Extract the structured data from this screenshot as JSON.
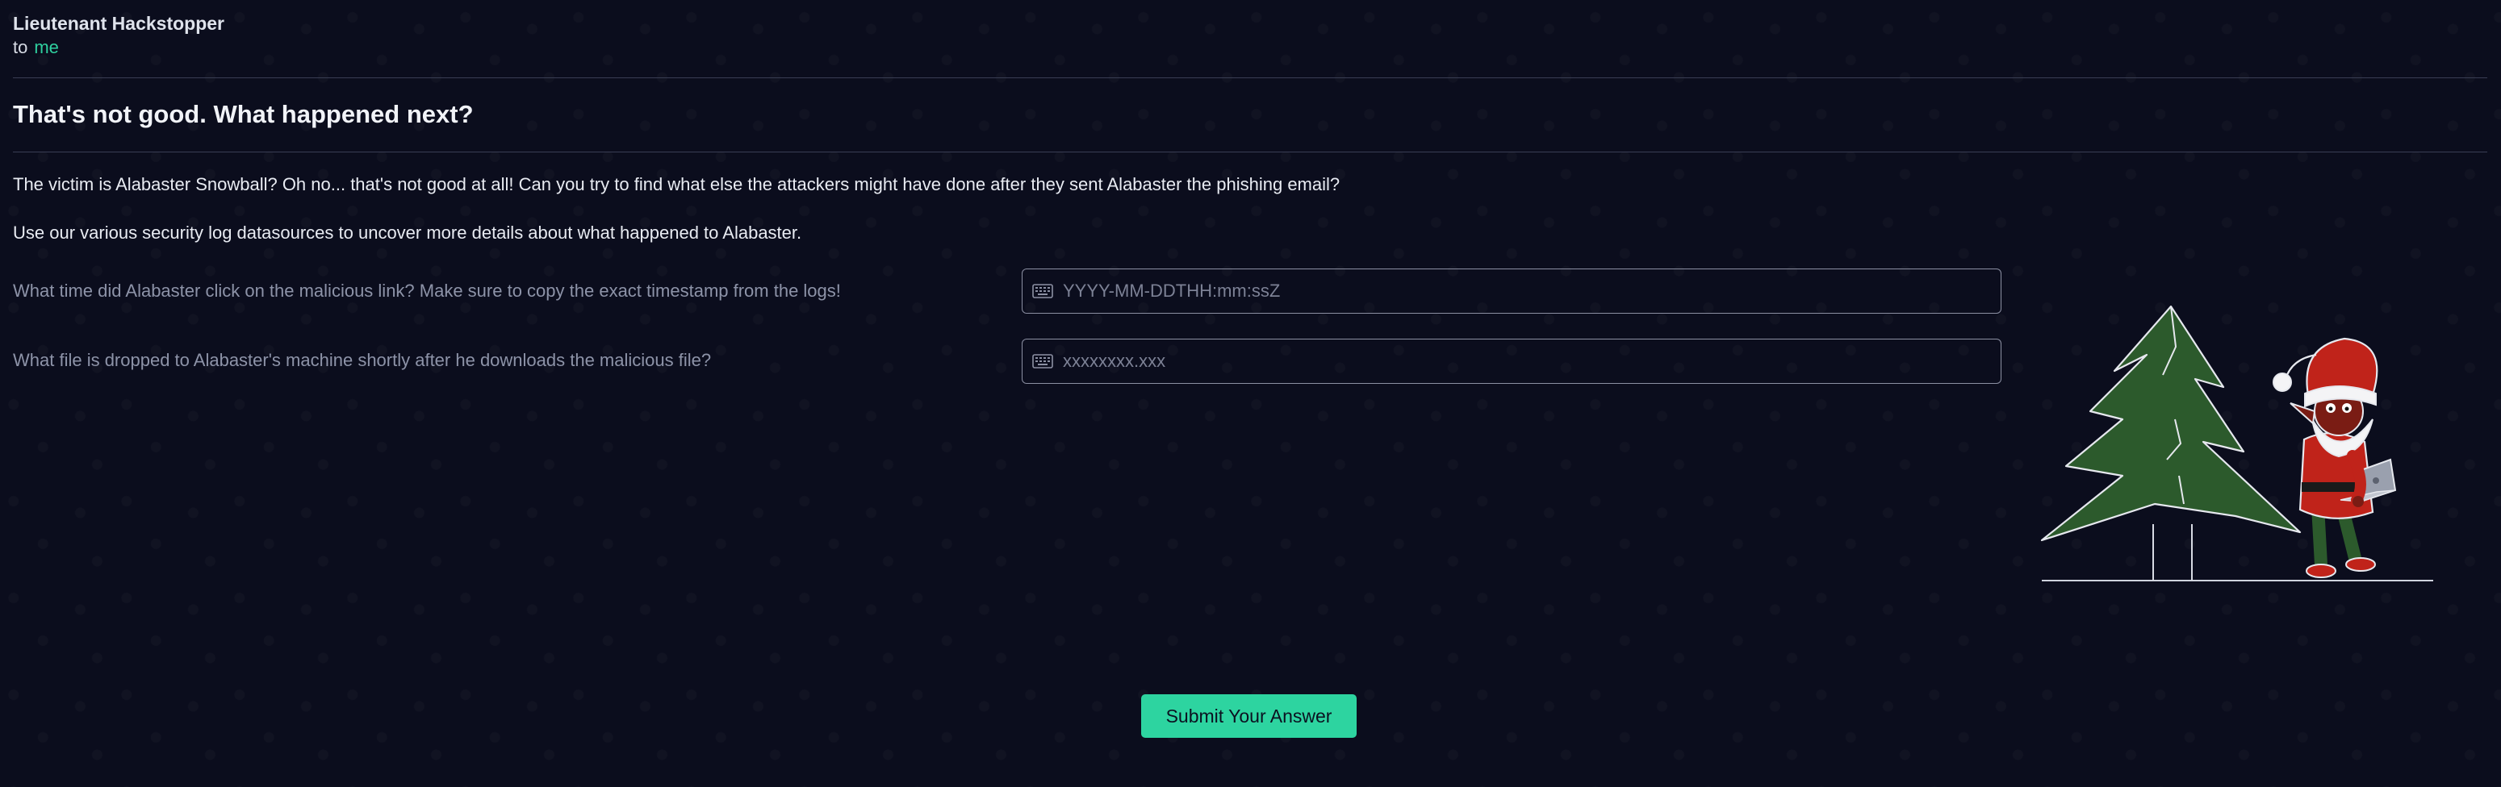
{
  "email": {
    "sender": "Lieutenant Hackstopper",
    "to_label": "to",
    "recipient": "me",
    "subject": "That's not good. What happened next?"
  },
  "body": {
    "paragraph1": "The victim is Alabaster Snowball? Oh no... that's not good at all! Can you try to find what else the attackers might have done after they sent Alabaster the phishing email?",
    "paragraph2": "Use our various security log datasources to uncover more details about what happened to Alabaster."
  },
  "questions": [
    {
      "label": "What time did Alabaster click on the malicious link? Make sure to copy the exact timestamp from the logs!",
      "placeholder": "YYYY-MM-DDTHH:mm:ssZ",
      "value": ""
    },
    {
      "label": "What file is dropped to Alabaster's machine shortly after he downloads the malicious file?",
      "placeholder": "xxxxxxxx.xxx",
      "value": ""
    }
  ],
  "submit_label": "Submit Your Answer",
  "icons": {
    "input_icon": "keyboard-icon",
    "illustration": "elf-with-laptop-and-christmas-tree"
  },
  "colors": {
    "background": "#0b0d1d",
    "accent": "#2dd4a0",
    "recipient": "#2fcf9f",
    "tree": "#2c5a2c",
    "elf_suit": "#c0231a"
  }
}
